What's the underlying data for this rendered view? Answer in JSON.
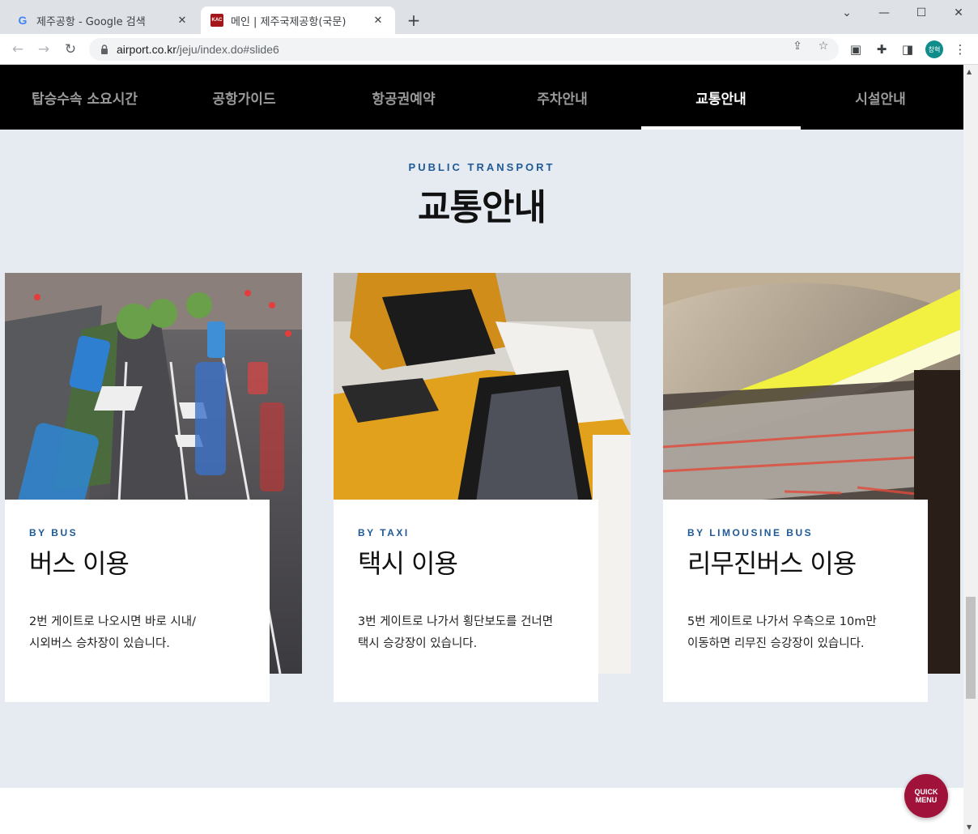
{
  "browser": {
    "tabs": [
      {
        "title": "제주공항 - Google 검색",
        "favicon": "google-g-icon"
      },
      {
        "title": "메인 | 제주국제공항(국문)",
        "favicon": "kac-logo-icon"
      }
    ],
    "kac_favicon_text": "KAC",
    "url_host": "airport.co.kr",
    "url_path": "/jeju/index.do#slide6",
    "profile_label": "창혁"
  },
  "nav": {
    "items": [
      "탑승수속 소요시간",
      "공항가이드",
      "항공권예약",
      "주차안내",
      "교통안내",
      "시설안내"
    ],
    "active_index": 4
  },
  "section": {
    "eyebrow": "PUBLIC TRANSPORT",
    "title": "교통안내"
  },
  "cards": [
    {
      "eyebrow": "BY BUS",
      "title": "버스 이용",
      "desc": "2번 게이트로 나오시면 바로 시내/\n시외버스 승차장이 있습니다.",
      "image": "bus-traffic-photo"
    },
    {
      "eyebrow": "BY TAXI",
      "title": "택시 이용",
      "desc": "3번 게이트로 나가서 횡단보도를 건너면\n택시 승강장이 있습니다.",
      "image": "taxi-photo"
    },
    {
      "eyebrow": "BY LIMOUSINE BUS",
      "title": "리무진버스 이용",
      "desc": "5번 게이트로 나가서 우측으로 10m만\n이동하면 리무진 승강장이 있습니다.",
      "image": "subway-train-photo"
    }
  ],
  "quick_menu": {
    "line1": "QUICK",
    "line2": "MENU"
  },
  "colors": {
    "accent_blue": "#1f5a96",
    "quick_menu": "#a0123a",
    "nav_bg": "#000000",
    "page_bg": "#e6ebf2"
  }
}
